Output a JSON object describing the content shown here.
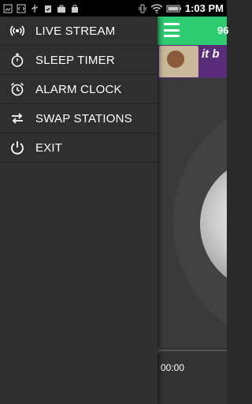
{
  "status_bar": {
    "time": "1:03 PM",
    "left_icons": [
      "image-icon",
      "code-icon",
      "usb-icon",
      "clipboard-check-icon",
      "briefcase-icon",
      "shopping-bag-icon"
    ],
    "right_icons": [
      "vibrate-icon",
      "wifi-icon",
      "battery-icon"
    ]
  },
  "drawer": {
    "items": [
      {
        "label": "LIVE STREAM",
        "icon": "broadcast-icon"
      },
      {
        "label": "SLEEP TIMER",
        "icon": "stopwatch-icon"
      },
      {
        "label": "ALARM CLOCK",
        "icon": "alarm-clock-icon"
      },
      {
        "label": "SWAP STATIONS",
        "icon": "swap-icon"
      },
      {
        "label": "EXIT",
        "icon": "power-icon"
      }
    ]
  },
  "app": {
    "toolbar_text": "96",
    "accent_color": "#2ecc71",
    "ad_text": "it b",
    "elapsed_time": "00:00"
  }
}
